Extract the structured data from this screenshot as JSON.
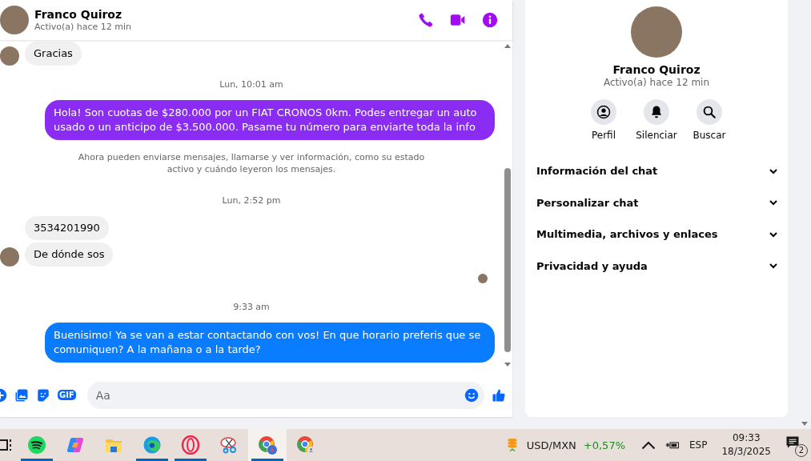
{
  "chat": {
    "contact": {
      "name": "Franco Quiroz",
      "status": "Activo(a) hace 12 min"
    },
    "messages": [
      {
        "kind": "incoming",
        "text": "Gracias",
        "show_avatar": true
      },
      {
        "kind": "time",
        "text": "Lun, 10:01 am"
      },
      {
        "kind": "outgoing",
        "text": "Hola! Son cuotas de $280.000 por un FIAT CRONOS 0km. Podes entregar un auto usado o un anticipo de $3.500.000. Pasame tu número para enviarte toda la info",
        "color": "#8b2cf5"
      },
      {
        "kind": "notice",
        "text": "Ahora pueden enviarse mensajes, llamarse y ver información, como su estado activo y cuándo leyeron los mensajes."
      },
      {
        "kind": "time",
        "text": "Lun, 2:52 pm"
      },
      {
        "kind": "incoming",
        "text": "3534201990",
        "show_avatar": false
      },
      {
        "kind": "incoming",
        "text": "De dónde sos",
        "show_avatar": true
      },
      {
        "kind": "seen"
      },
      {
        "kind": "time",
        "text": "9:33 am"
      },
      {
        "kind": "outgoing",
        "text": "Buenisimo! Ya se van a estar contactando con vos! En que horario preferis que se comuniquen? A la mañana o a la tarde?",
        "color": "#0a7cff"
      }
    ],
    "composer": {
      "gif_label": "GIF",
      "placeholder": "Aa"
    }
  },
  "details": {
    "name": "Franco Quiroz",
    "status": "Activo(a) hace 12 min",
    "actions": [
      {
        "kind": "profile",
        "label": "Perfil"
      },
      {
        "kind": "mute",
        "label": "Silenciar"
      },
      {
        "kind": "search",
        "label": "Buscar"
      }
    ],
    "sections": [
      {
        "label": "Información del chat",
        "expanded": false
      },
      {
        "label": "Personalizar chat",
        "expanded": false
      },
      {
        "label": "Multimedia, archivos y enlaces",
        "expanded": false
      },
      {
        "label": "Privacidad y ayuda",
        "expanded": false
      }
    ]
  },
  "taskbar": {
    "apps": [
      {
        "kind": "taskview",
        "running": false,
        "selected": false
      },
      {
        "kind": "spotify",
        "running": true,
        "selected": false
      },
      {
        "kind": "copilot",
        "running": false,
        "selected": false
      },
      {
        "kind": "files",
        "running": false,
        "selected": false
      },
      {
        "kind": "edge",
        "running": true,
        "selected": false
      },
      {
        "kind": "opera",
        "running": true,
        "selected": false
      },
      {
        "kind": "snip",
        "running": false,
        "selected": false
      },
      {
        "kind": "chrome-badge",
        "running": true,
        "selected": true
      },
      {
        "kind": "chrome-profile",
        "running": false,
        "selected": false
      }
    ],
    "widget": {
      "label": "USD/MXN",
      "change": "+0,57%"
    },
    "language": "ESP",
    "time": "09:33",
    "date": "18/3/2025",
    "notifications": "2"
  }
}
